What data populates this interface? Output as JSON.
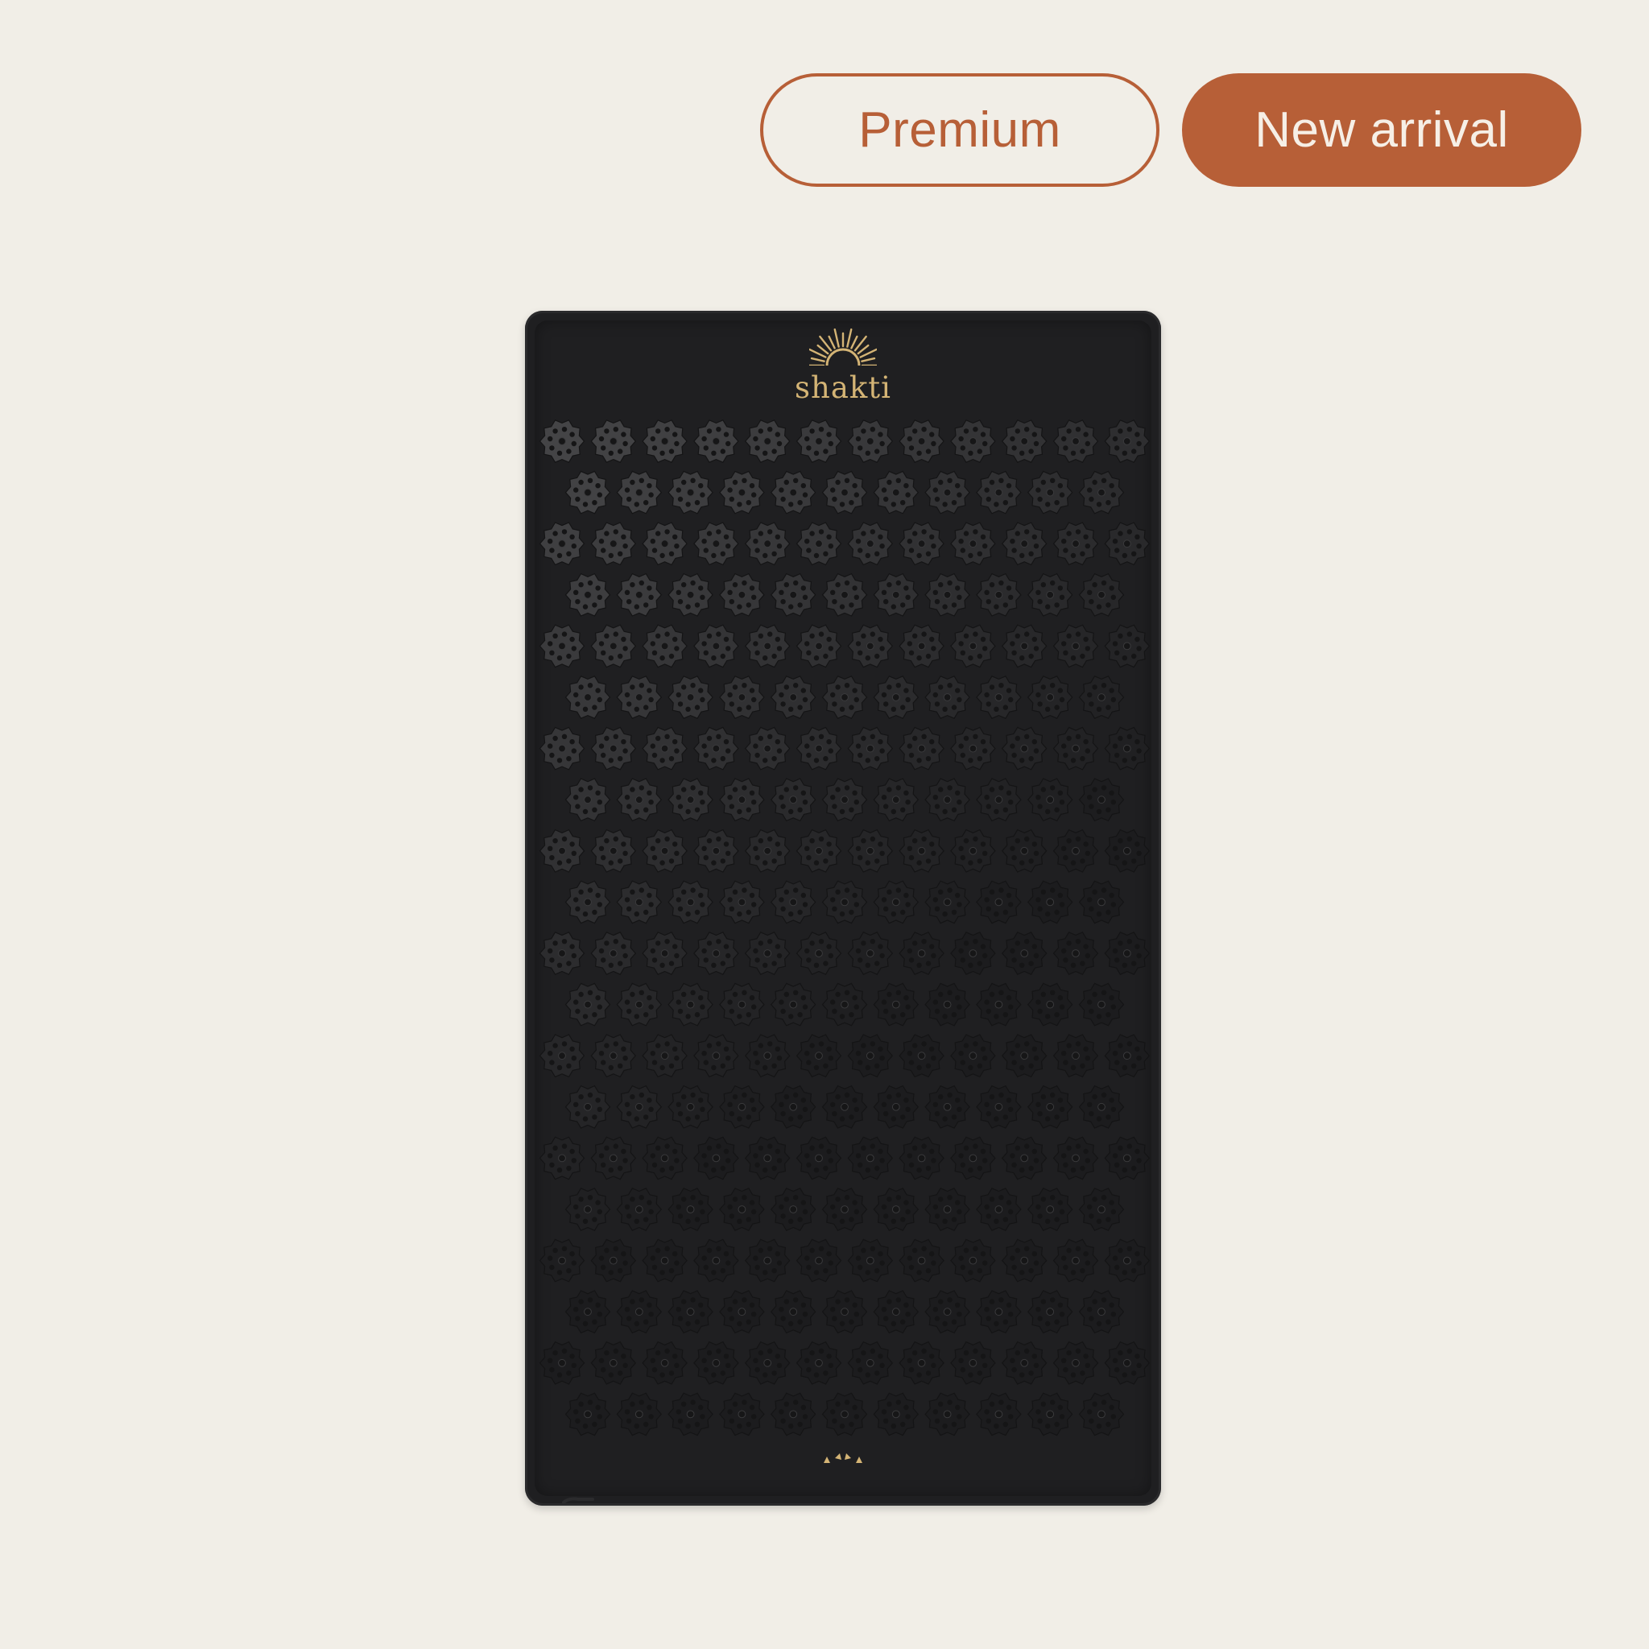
{
  "badges": {
    "premium": "Premium",
    "new_arrival": "New arrival"
  },
  "product": {
    "brand_logo_text": "shakti"
  },
  "colors": {
    "background": "#f1eee7",
    "accent": "#b75f37",
    "mat": "#1f1f21",
    "logo_gold": "#d4b475"
  }
}
